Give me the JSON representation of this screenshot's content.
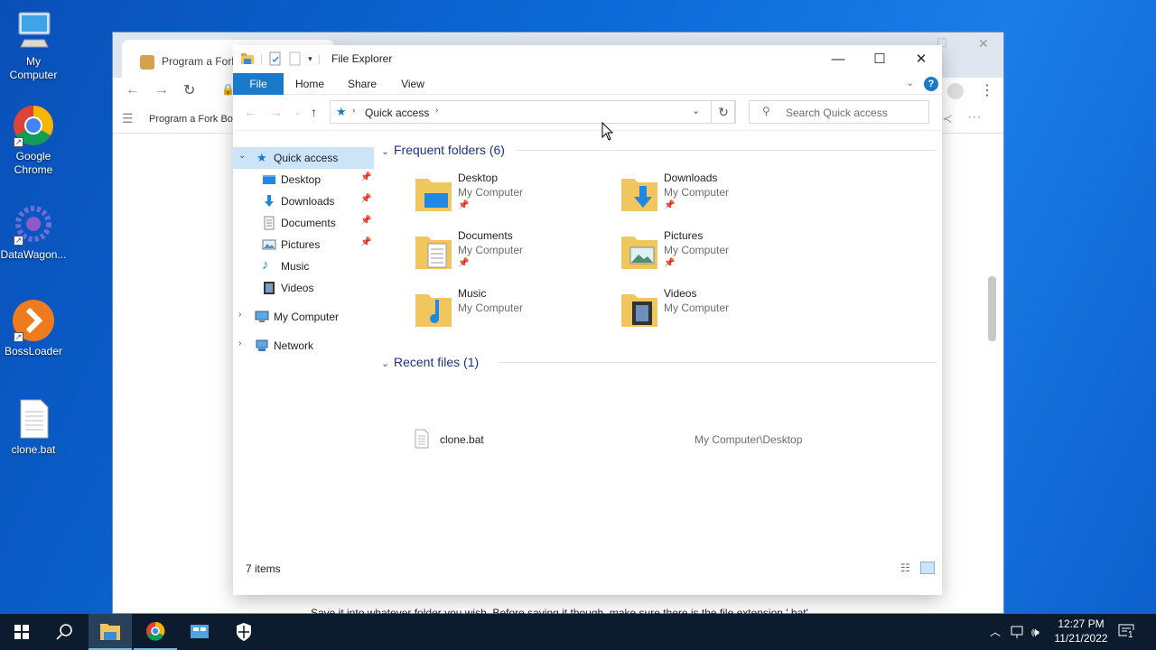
{
  "desktop": {
    "icons": [
      {
        "label": "My\nComputer",
        "icon": "computer-icon"
      },
      {
        "label": "Google Chrome",
        "icon": "chrome-icon"
      },
      {
        "label": "DataWagon...",
        "icon": "datawagon-icon"
      },
      {
        "label": "BossLoader",
        "icon": "bossloader-icon"
      },
      {
        "label": "clone.bat",
        "icon": "batch-file-icon"
      }
    ]
  },
  "browser": {
    "tab_title": "Program a Fork B",
    "bookmark": "Program a Fork Bom",
    "page_text": "Save it into whatever folder you wish. Before saving it though, make sure there is the file extension '.bat' (including period, without quotes) after the file name and save it as 'all files'."
  },
  "explorer": {
    "title": "File Explorer",
    "ribbon_tabs": [
      "File",
      "Home",
      "Share",
      "View"
    ],
    "address": "Quick access",
    "search_placeholder": "Search Quick access",
    "nav": {
      "quick_access": "Quick access",
      "items": [
        "Desktop",
        "Downloads",
        "Documents",
        "Pictures",
        "Music",
        "Videos"
      ],
      "my_computer": "My Computer",
      "network": "Network"
    },
    "frequent_header": "Frequent folders (6)",
    "folders": [
      {
        "name": "Desktop",
        "location": "My Computer",
        "pinned": true
      },
      {
        "name": "Downloads",
        "location": "My Computer",
        "pinned": true
      },
      {
        "name": "Documents",
        "location": "My Computer",
        "pinned": true
      },
      {
        "name": "Pictures",
        "location": "My Computer",
        "pinned": true
      },
      {
        "name": "Music",
        "location": "My Computer",
        "pinned": false
      },
      {
        "name": "Videos",
        "location": "My Computer",
        "pinned": false
      }
    ],
    "recent_header": "Recent files (1)",
    "recent": [
      {
        "name": "clone.bat",
        "path": "My Computer\\Desktop"
      }
    ],
    "status": "7 items"
  },
  "taskbar": {
    "time": "12:27 PM",
    "date": "11/21/2022",
    "notification_count": "1"
  }
}
